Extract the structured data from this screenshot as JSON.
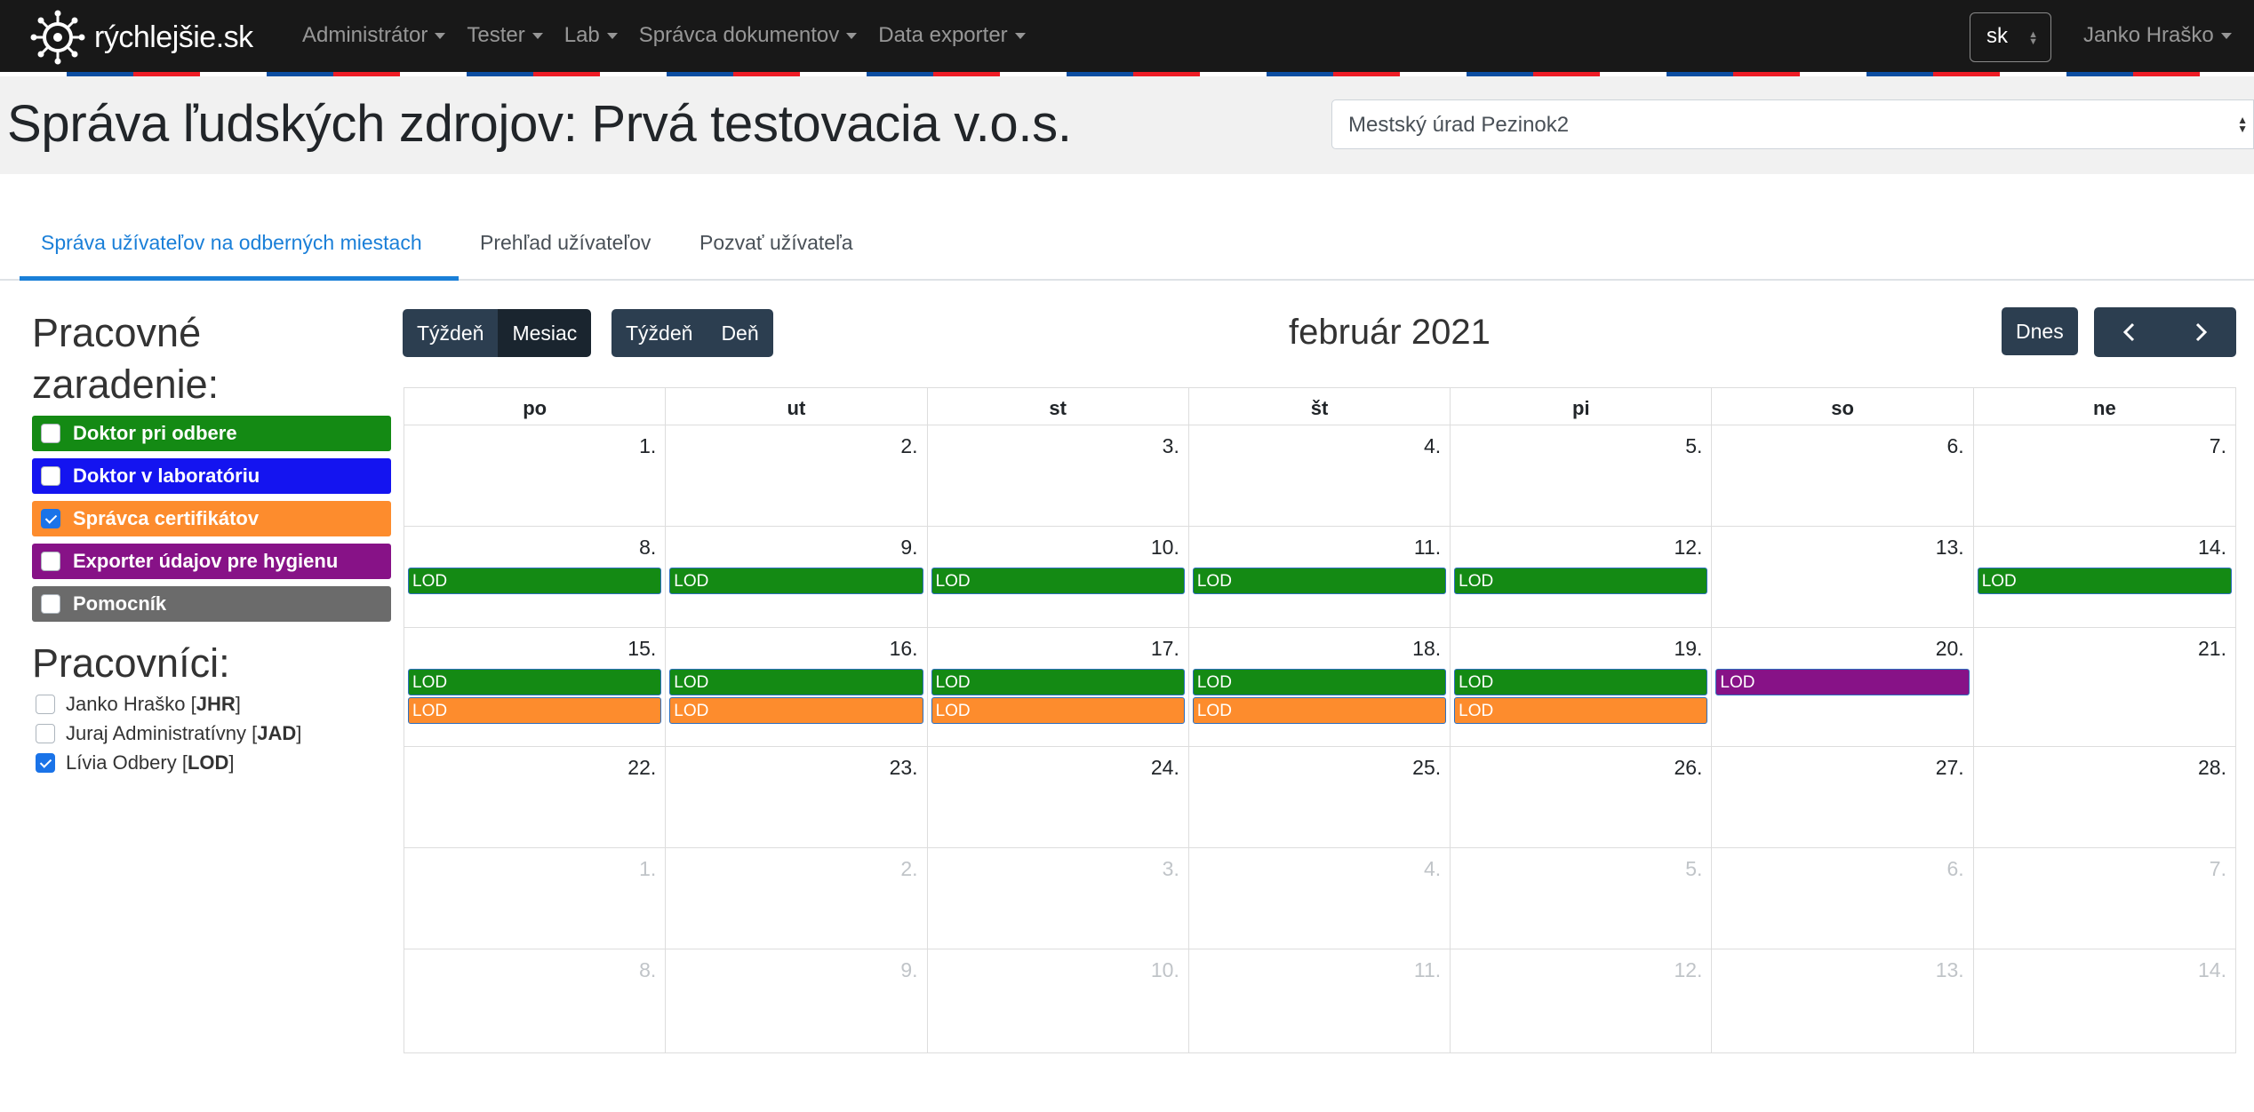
{
  "navbar": {
    "brand": "rýchlejšie.sk",
    "menu": [
      {
        "label": "Administrátor"
      },
      {
        "label": "Tester"
      },
      {
        "label": "Lab"
      },
      {
        "label": "Správca dokumentov"
      },
      {
        "label": "Data exporter"
      }
    ],
    "lang": "sk",
    "user": "Janko Hraško"
  },
  "header": {
    "title": "Správa ľudských zdrojov: Prvá testovacia v.o.s.",
    "site_select": "Mestský úrad Pezinok2"
  },
  "tabs": [
    {
      "label": "Správa užívateľov na odberných miestach",
      "active": true
    },
    {
      "label": "Prehľad užívateľov",
      "active": false
    },
    {
      "label": "Pozvať užívateľa",
      "active": false
    }
  ],
  "sidebar": {
    "roles_heading": "Pracovné zaradenie:",
    "roles": [
      {
        "label": "Doktor pri odbere",
        "color": "#148a14",
        "checked": false
      },
      {
        "label": "Doktor v laboratóriu",
        "color": "#1414f0",
        "checked": false
      },
      {
        "label": "Správca certifikátov",
        "color": "#fd8c2d",
        "checked": true
      },
      {
        "label": "Exporter údajov pre hygienu",
        "color": "#871287",
        "checked": false
      },
      {
        "label": "Pomocník",
        "color": "#6b6b6b",
        "checked": false
      }
    ],
    "workers_heading": "Pracovníci:",
    "workers": [
      {
        "name": "Janko Hraško",
        "code": "JHR",
        "checked": false
      },
      {
        "name": "Juraj Administratívny",
        "code": "JAD",
        "checked": false
      },
      {
        "name": "Lívia Odbery",
        "code": "LOD",
        "checked": true
      }
    ]
  },
  "calendar": {
    "view_buttons_1": [
      {
        "label": "Týždeň",
        "active": false
      },
      {
        "label": "Mesiac",
        "active": true
      }
    ],
    "view_buttons_2": [
      {
        "label": "Týždeň",
        "active": false
      },
      {
        "label": "Deň",
        "active": false
      }
    ],
    "title": "február 2021",
    "today_label": "Dnes",
    "weekdays": [
      "po",
      "ut",
      "st",
      "št",
      "pi",
      "so",
      "ne"
    ],
    "colors": {
      "green": "#148a14",
      "orange": "#fd8c2d",
      "purple": "#871287"
    },
    "weeks": [
      [
        {
          "num": "1.",
          "events": []
        },
        {
          "num": "2.",
          "events": []
        },
        {
          "num": "3.",
          "events": []
        },
        {
          "num": "4.",
          "events": []
        },
        {
          "num": "5.",
          "events": []
        },
        {
          "num": "6.",
          "events": []
        },
        {
          "num": "7.",
          "events": []
        }
      ],
      [
        {
          "num": "8.",
          "events": [
            {
              "label": "LOD",
              "color": "green"
            }
          ]
        },
        {
          "num": "9.",
          "events": [
            {
              "label": "LOD",
              "color": "green"
            }
          ]
        },
        {
          "num": "10.",
          "events": [
            {
              "label": "LOD",
              "color": "green"
            }
          ]
        },
        {
          "num": "11.",
          "events": [
            {
              "label": "LOD",
              "color": "green"
            }
          ]
        },
        {
          "num": "12.",
          "events": [
            {
              "label": "LOD",
              "color": "green"
            }
          ]
        },
        {
          "num": "13.",
          "events": []
        },
        {
          "num": "14.",
          "events": [
            {
              "label": "LOD",
              "color": "green"
            }
          ]
        }
      ],
      [
        {
          "num": "15.",
          "events": [
            {
              "label": "LOD",
              "color": "green"
            },
            {
              "label": "LOD",
              "color": "orange"
            }
          ]
        },
        {
          "num": "16.",
          "events": [
            {
              "label": "LOD",
              "color": "green"
            },
            {
              "label": "LOD",
              "color": "orange"
            }
          ]
        },
        {
          "num": "17.",
          "events": [
            {
              "label": "LOD",
              "color": "green"
            },
            {
              "label": "LOD",
              "color": "orange"
            }
          ]
        },
        {
          "num": "18.",
          "events": [
            {
              "label": "LOD",
              "color": "green"
            },
            {
              "label": "LOD",
              "color": "orange"
            }
          ]
        },
        {
          "num": "19.",
          "events": [
            {
              "label": "LOD",
              "color": "green"
            },
            {
              "label": "LOD",
              "color": "orange"
            }
          ]
        },
        {
          "num": "20.",
          "events": [
            {
              "label": "LOD",
              "color": "purple"
            }
          ]
        },
        {
          "num": "21.",
          "events": []
        }
      ],
      [
        {
          "num": "22.",
          "events": []
        },
        {
          "num": "23.",
          "events": []
        },
        {
          "num": "24.",
          "events": []
        },
        {
          "num": "25.",
          "events": []
        },
        {
          "num": "26.",
          "events": []
        },
        {
          "num": "27.",
          "events": []
        },
        {
          "num": "28.",
          "events": []
        }
      ],
      [
        {
          "num": "1.",
          "other": true,
          "events": []
        },
        {
          "num": "2.",
          "other": true,
          "events": []
        },
        {
          "num": "3.",
          "other": true,
          "events": []
        },
        {
          "num": "4.",
          "other": true,
          "events": []
        },
        {
          "num": "5.",
          "other": true,
          "events": []
        },
        {
          "num": "6.",
          "other": true,
          "events": []
        },
        {
          "num": "7.",
          "other": true,
          "events": []
        }
      ],
      [
        {
          "num": "8.",
          "other": true,
          "events": []
        },
        {
          "num": "9.",
          "other": true,
          "events": []
        },
        {
          "num": "10.",
          "other": true,
          "events": []
        },
        {
          "num": "11.",
          "other": true,
          "events": []
        },
        {
          "num": "12.",
          "other": true,
          "events": []
        },
        {
          "num": "13.",
          "other": true,
          "events": []
        },
        {
          "num": "14.",
          "other": true,
          "events": []
        }
      ]
    ]
  }
}
